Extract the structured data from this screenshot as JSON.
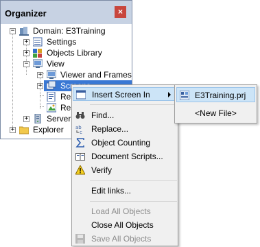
{
  "organizer": {
    "title": "Organizer",
    "close_label": "×",
    "tree": [
      {
        "label": "Domain: E3Training",
        "icon": "domain-icon"
      },
      {
        "label": "Settings",
        "icon": "settings-icon"
      },
      {
        "label": "Objects Library",
        "icon": "library-icon"
      },
      {
        "label": "View",
        "icon": "view-icon"
      },
      {
        "label": "Viewer and Frames",
        "icon": "viewer-icon"
      },
      {
        "label": "Screens",
        "icon": "screens-icon"
      },
      {
        "label": "Rep",
        "icon": "report-icon"
      },
      {
        "label": "Res",
        "icon": "resource-icon"
      },
      {
        "label": "Server o",
        "icon": "server-icon"
      },
      {
        "label": "Explorer",
        "icon": "folder-icon"
      }
    ]
  },
  "context_menu": {
    "insert_screen_in": "Insert Screen In",
    "find": "Find...",
    "replace": "Replace...",
    "object_counting": "Object Counting",
    "document_scripts": "Document Scripts...",
    "verify": "Verify",
    "edit_links": "Edit links...",
    "load_all_objects": "Load All Objects",
    "close_all_objects": "Close All Objects",
    "save_all_objects": "Save All Objects"
  },
  "submenu": {
    "project": "E3Training.prj",
    "new_file": "<New File>"
  },
  "colors": {
    "selection": "#3a78d4",
    "menu_highlight": "#cce4f7",
    "title_bar": "#c7d2e3",
    "close_button": "#c8463d"
  }
}
